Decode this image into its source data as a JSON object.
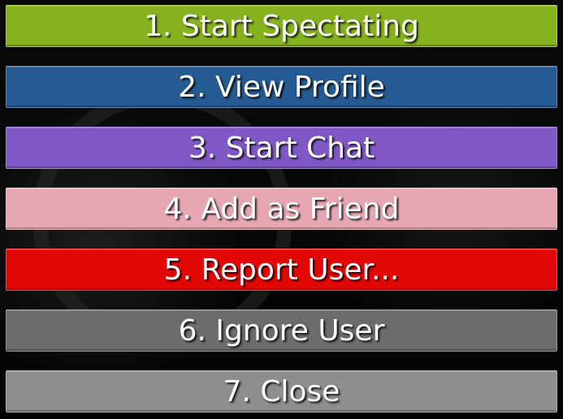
{
  "menu": {
    "items": [
      {
        "label": "1. Start Spectating",
        "color": "#86b21f"
      },
      {
        "label": "2. View Profile",
        "color": "#255a93"
      },
      {
        "label": "3. Start Chat",
        "color": "#7f58c6"
      },
      {
        "label": "4. Add as Friend",
        "color": "#e6a7b3"
      },
      {
        "label": "5. Report User...",
        "color": "#e20707"
      },
      {
        "label": "6. Ignore User",
        "color": "#6c6c6c"
      },
      {
        "label": "7. Close",
        "color": "#8e8e8e"
      }
    ]
  }
}
